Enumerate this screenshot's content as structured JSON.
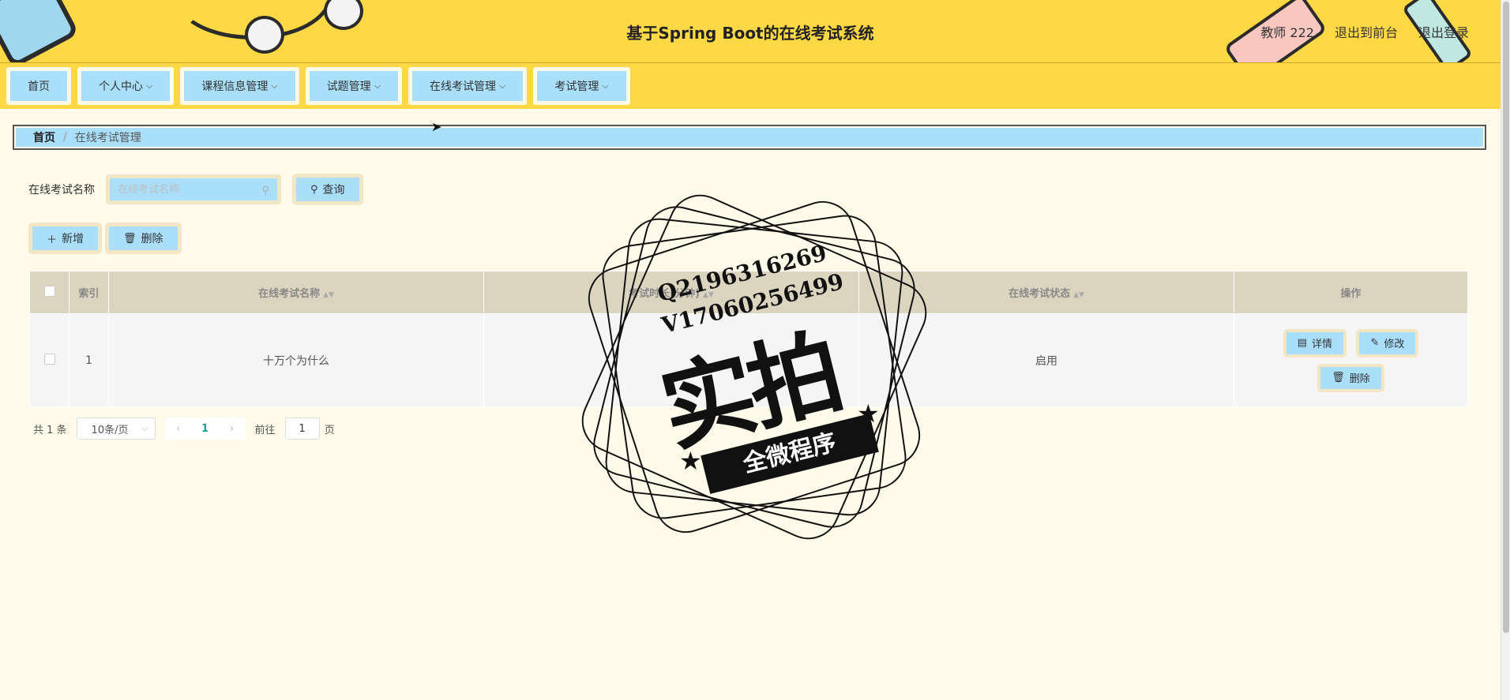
{
  "header": {
    "title": "基于Spring Boot的在线考试系统",
    "user": "教师 222",
    "front_link": "退出到前台",
    "logout": "退出登录"
  },
  "nav": {
    "items": [
      {
        "label": "首页"
      },
      {
        "label": "个人中心"
      },
      {
        "label": "课程信息管理"
      },
      {
        "label": "试题管理"
      },
      {
        "label": "在线考试管理"
      },
      {
        "label": "考试管理"
      }
    ]
  },
  "breadcrumb": {
    "home": "首页",
    "separator": "/",
    "current": "在线考试管理"
  },
  "search": {
    "label": "在线考试名称",
    "placeholder": "在线考试名称",
    "value": "",
    "query_label": "查询"
  },
  "actions": {
    "add_label": "新增",
    "delete_label": "删除"
  },
  "table": {
    "headers": {
      "index": "索引",
      "name": "在线考试名称",
      "duration": "考试时长(分钟)",
      "status": "在线考试状态",
      "ops": "操作"
    },
    "rows": [
      {
        "index": "1",
        "name": "十万个为什么",
        "duration": "",
        "status": "启用"
      }
    ],
    "op_labels": {
      "detail": "详情",
      "edit": "修改",
      "delete": "删除"
    }
  },
  "pagination": {
    "total": "共 1 条",
    "page_size": "10条/页",
    "current_page": "1",
    "goto_label": "前往",
    "goto_value": "1",
    "page_suffix": "页"
  },
  "watermark": {
    "line1": "Q2196316269",
    "line2": "V17060256499",
    "big": "实拍",
    "band": "全微程序"
  },
  "colors": {
    "header_bg": "#fed845",
    "button_bg": "#a9dffb",
    "page_bg": "#fffbeb",
    "table_header": "#dbd5c0"
  }
}
